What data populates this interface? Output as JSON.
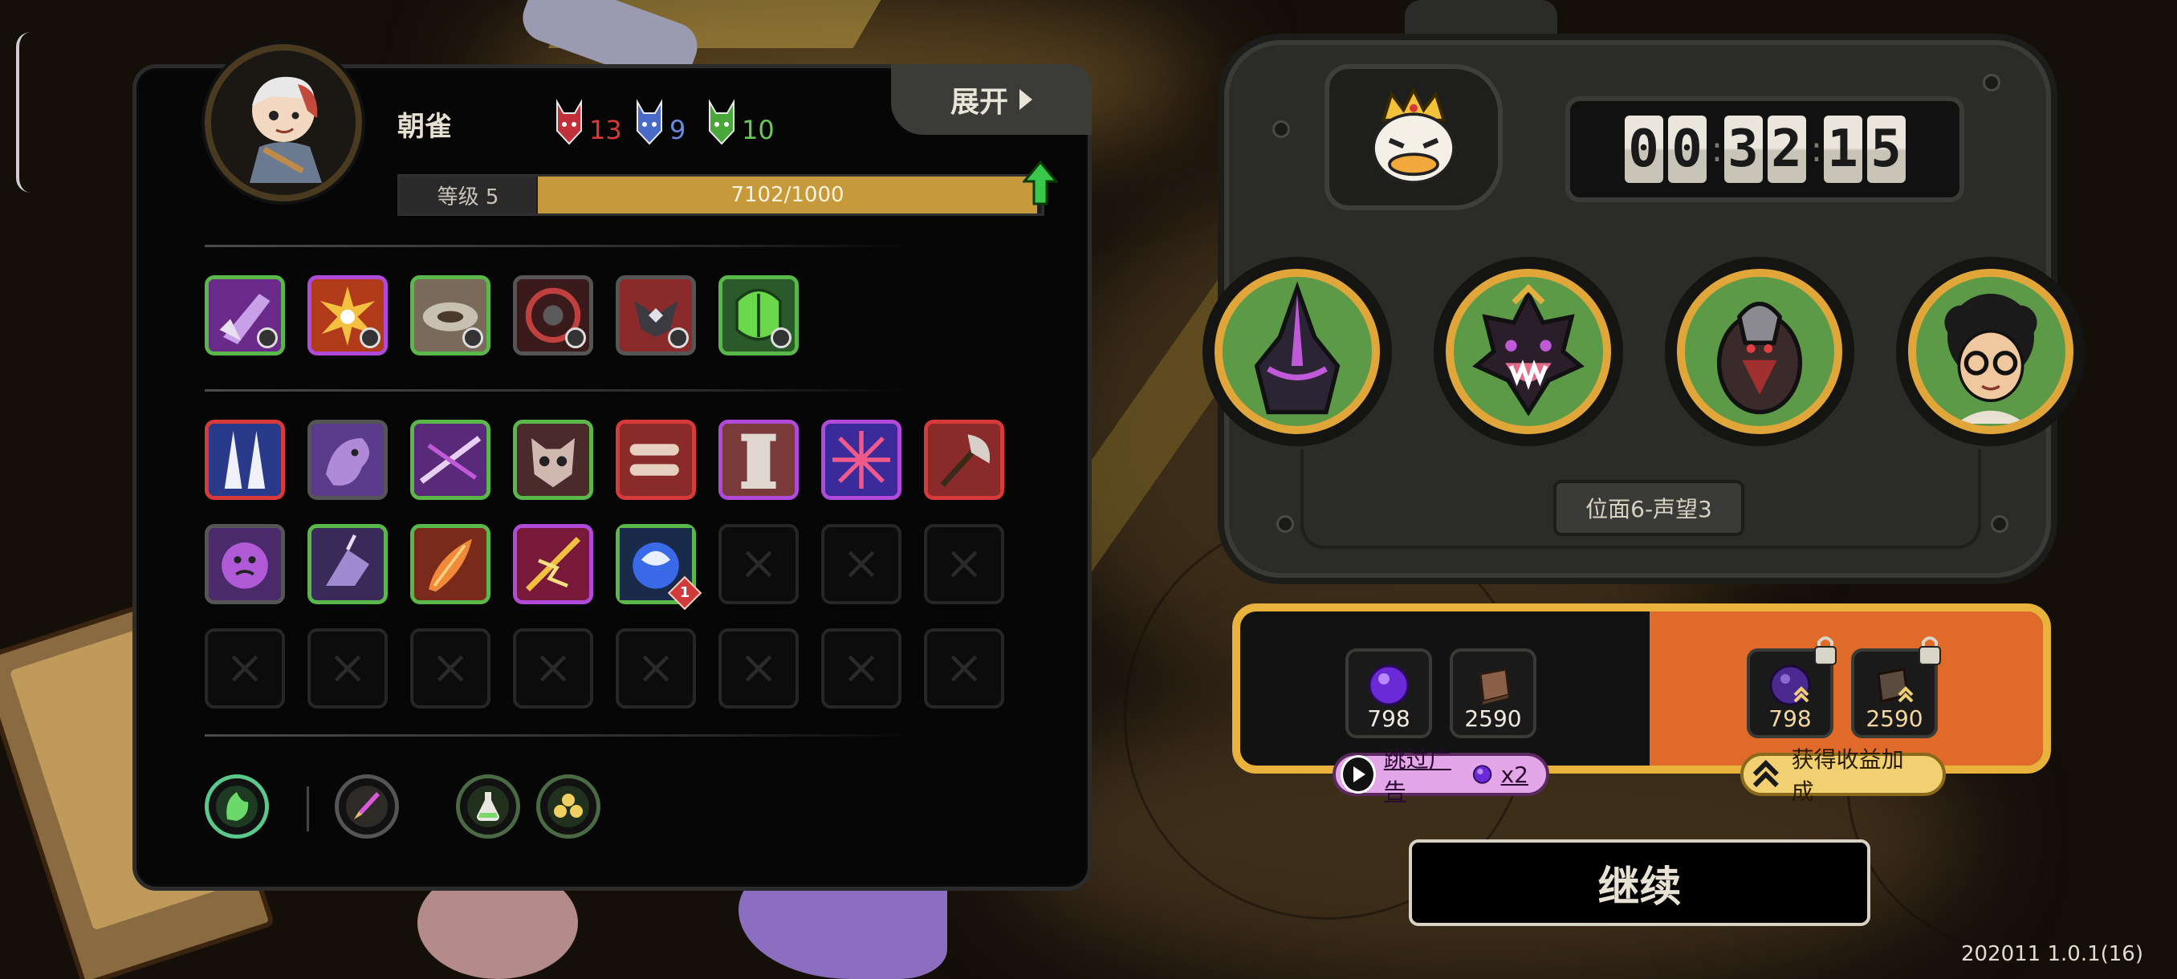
{
  "character": {
    "name": "朝雀",
    "factions": [
      {
        "icon": "red-mask-icon",
        "count": "13",
        "color": "#d83a3a"
      },
      {
        "icon": "blue-mask-icon",
        "count": "9",
        "color": "#5a7ad8"
      },
      {
        "icon": "green-mask-icon",
        "count": "10",
        "color": "#5ab84a"
      }
    ],
    "level_label": "等级 5",
    "xp_text": "7102/1000",
    "xp_fraction": 1.0,
    "expand_label": "展开"
  },
  "equipped_skills": [
    {
      "icon": "claw-strike-icon",
      "border": "#5ab84a"
    },
    {
      "icon": "explosion-burst-icon",
      "border": "#b04ad8"
    },
    {
      "icon": "disc-blade-icon",
      "border": "#5ab84a"
    },
    {
      "icon": "target-ring-icon",
      "border": "#555555"
    },
    {
      "icon": "horned-helm-icon",
      "border": "#555555"
    },
    {
      "icon": "green-carapace-icon",
      "border": "#5ab84a"
    }
  ],
  "inventory": [
    {
      "icon": "twin-spikes-icon",
      "border": "#d83a3a"
    },
    {
      "icon": "purple-beast-icon",
      "border": "#555555"
    },
    {
      "icon": "crossed-blades-icon",
      "border": "#5ab84a"
    },
    {
      "icon": "demon-skull-icon",
      "border": "#5ab84a"
    },
    {
      "icon": "twin-bullets-icon",
      "border": "#d83a3a"
    },
    {
      "icon": "stone-pillar-icon",
      "border": "#b04ad8"
    },
    {
      "icon": "cross-net-icon",
      "border": "#b04ad8"
    },
    {
      "icon": "battle-axe-icon",
      "border": "#d83a3a"
    },
    {
      "icon": "purple-face-icon",
      "border": "#555555"
    },
    {
      "icon": "purple-rider-icon",
      "border": "#5ab84a"
    },
    {
      "icon": "fire-feather-icon",
      "border": "#5ab84a"
    },
    {
      "icon": "lightning-spear-icon",
      "border": "#b04ad8"
    },
    {
      "icon": "blue-orb-icon",
      "border": "#5ab84a",
      "count": "1"
    },
    {
      "icon": "empty-slot-icon",
      "border": ""
    },
    {
      "icon": "empty-slot-icon",
      "border": ""
    },
    {
      "icon": "empty-slot-icon",
      "border": ""
    },
    {
      "icon": "empty-slot-icon",
      "border": ""
    },
    {
      "icon": "empty-slot-icon",
      "border": ""
    },
    {
      "icon": "empty-slot-icon",
      "border": ""
    },
    {
      "icon": "empty-slot-icon",
      "border": ""
    },
    {
      "icon": "empty-slot-icon",
      "border": ""
    },
    {
      "icon": "empty-slot-icon",
      "border": ""
    },
    {
      "icon": "empty-slot-icon",
      "border": ""
    },
    {
      "icon": "empty-slot-icon",
      "border": ""
    }
  ],
  "abilities": [
    {
      "icon": "green-spirit-icon"
    },
    {
      "icon": "dagger-icon"
    },
    {
      "icon": "potion-icon"
    },
    {
      "icon": "triple-orb-icon"
    }
  ],
  "timer": {
    "digits": [
      "0",
      "0",
      "3",
      "2",
      "1",
      "5"
    ]
  },
  "boss_icon": "crowned-duck-icon",
  "heroes": [
    {
      "icon": "dark-knight-icon"
    },
    {
      "icon": "fanged-demon-icon"
    },
    {
      "icon": "hooded-beetle-icon"
    },
    {
      "icon": "curly-hair-glasses-icon"
    }
  ],
  "stage": "位面6-声望3",
  "rewards": {
    "base": [
      {
        "icon": "purple-gem-icon",
        "value": "798"
      },
      {
        "icon": "leather-book-icon",
        "value": "2590"
      }
    ],
    "bonus": [
      {
        "icon": "purple-gem-boost-icon",
        "value": "798"
      },
      {
        "icon": "leather-book-boost-icon",
        "value": "2590"
      }
    ]
  },
  "ad_button": {
    "label": "跳过广告",
    "multiplier": "x2"
  },
  "bonus_button": {
    "label": "获得收益加成"
  },
  "continue_label": "继续",
  "version": "202011 1.0.1(16)"
}
